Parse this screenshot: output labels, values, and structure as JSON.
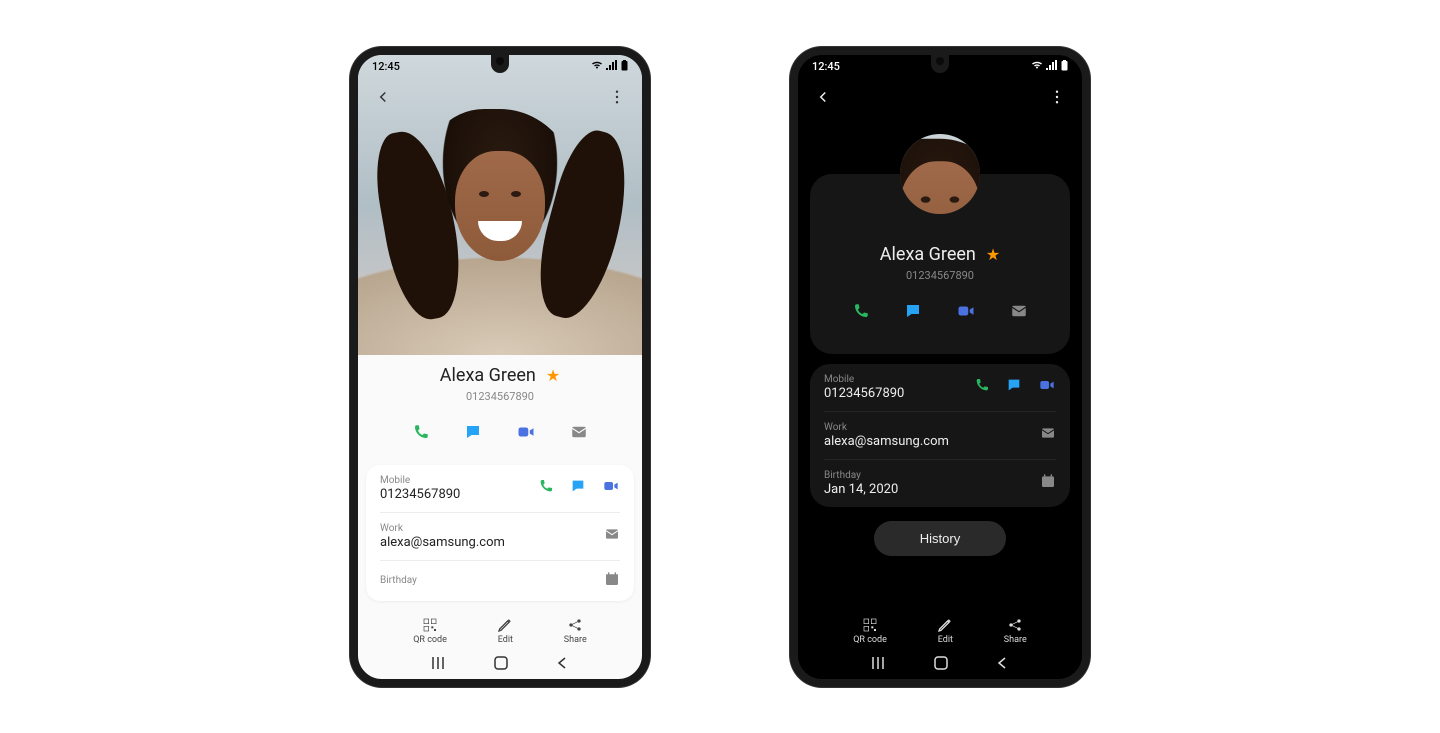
{
  "status": {
    "time": "12:45"
  },
  "contact": {
    "name": "Alexa Green",
    "primary_number": "01234567890"
  },
  "details": {
    "mobile_label": "Mobile",
    "mobile_value": "01234567890",
    "work_label": "Work",
    "work_value": "alexa@samsung.com",
    "birthday_label": "Birthday",
    "birthday_value": "Jan 14, 2020"
  },
  "buttons": {
    "history": "History"
  },
  "bottom_actions": {
    "qr": "QR code",
    "edit": "Edit",
    "share": "Share"
  }
}
